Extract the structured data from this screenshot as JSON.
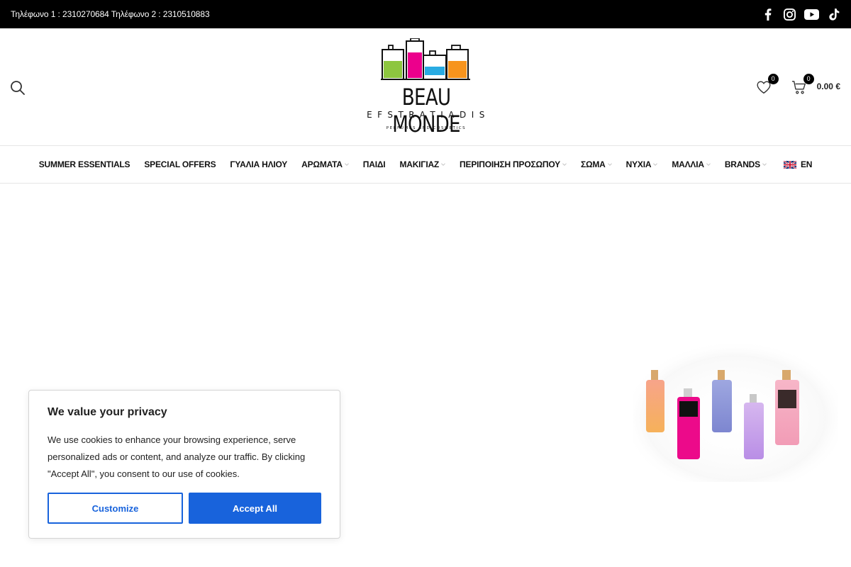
{
  "topbar": {
    "phones": "Τηλέφωνο 1 : 2310270684 Τηλέφωνο 2 : 2310510883",
    "social": [
      "facebook-icon",
      "instagram-icon",
      "youtube-icon",
      "tiktok-icon"
    ]
  },
  "logo": {
    "brand": "BEAU MONDE",
    "sub1": "EFSTRATIADIS",
    "sub2": "PERFUMES AND COSMETICS",
    "bottle_colors": [
      "#8dc63f",
      "#ec008c",
      "#29abe2",
      "#f7941d"
    ]
  },
  "header": {
    "wishlist_count": "0",
    "cart_count": "0",
    "cart_total": "0.00 €"
  },
  "nav": {
    "items": [
      {
        "label": "SUMMER ESSENTIALS",
        "has_dropdown": false
      },
      {
        "label": "SPECIAL OFFERS",
        "has_dropdown": false
      },
      {
        "label": "ΓΥΑΛΙΑ ΗΛΙΟΥ",
        "has_dropdown": false
      },
      {
        "label": "ΑΡΩΜΑΤΑ",
        "has_dropdown": true
      },
      {
        "label": "ΠΑΙΔΙ",
        "has_dropdown": false
      },
      {
        "label": "ΜΑΚΙΓΙΑΖ",
        "has_dropdown": true
      },
      {
        "label": "ΠΕΡΙΠΟΙΗΣΗ ΠΡΟΣΩΠΟΥ",
        "has_dropdown": true
      },
      {
        "label": "ΣΩΜΑ",
        "has_dropdown": true
      },
      {
        "label": "ΝΥΧΙΑ",
        "has_dropdown": true
      },
      {
        "label": "ΜΑΛΛΙΑ",
        "has_dropdown": true
      },
      {
        "label": "BRANDS",
        "has_dropdown": true
      }
    ],
    "language": "EN"
  },
  "cookie": {
    "title": "We value your privacy",
    "text": "We use cookies to enhance your browsing experience, serve personalized ads or content, and analyze our traffic. By clicking \"Accept All\", you consent to our use of cookies.",
    "customize_label": "Customize",
    "accept_label": "Accept All",
    "accent_color": "#1863dc"
  }
}
